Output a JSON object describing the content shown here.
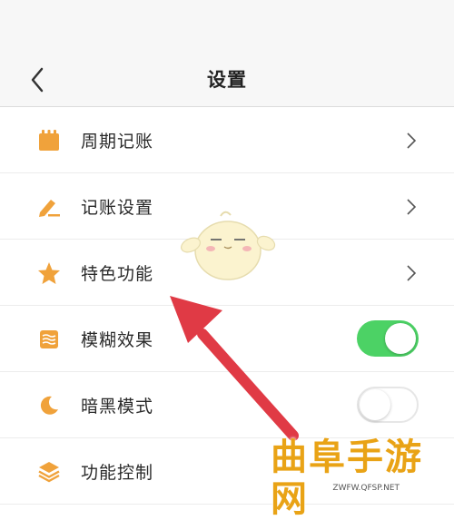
{
  "header": {
    "title": "设置"
  },
  "settings": [
    {
      "label": "周期记账",
      "icon": "calendar-icon",
      "type": "link"
    },
    {
      "label": "记账设置",
      "icon": "pencil-icon",
      "type": "link"
    },
    {
      "label": "特色功能",
      "icon": "star-icon",
      "type": "link"
    },
    {
      "label": "模糊效果",
      "icon": "blur-layers-icon",
      "type": "toggle",
      "enabled": true
    },
    {
      "label": "暗黑模式",
      "icon": "moon-icon",
      "type": "toggle",
      "enabled": false
    },
    {
      "label": "功能控制",
      "icon": "stack-icon",
      "type": "item"
    }
  ],
  "watermark": {
    "logo": "曲阜手游网",
    "url": "ZWFW.QFSP.NET"
  },
  "colors": {
    "accent": "#f0a23b",
    "toggle_on": "#4cd265",
    "arrow": "#e03a45"
  }
}
